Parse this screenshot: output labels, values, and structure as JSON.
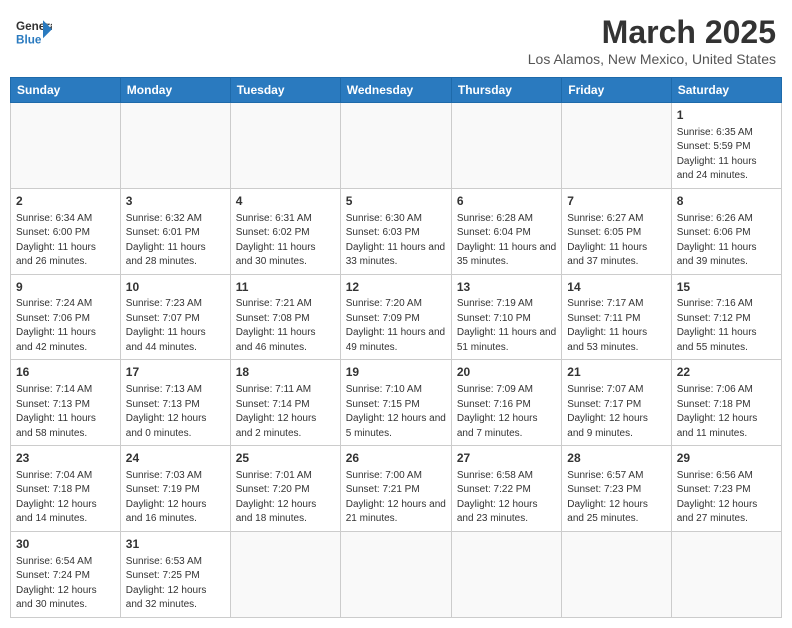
{
  "header": {
    "logo_general": "General",
    "logo_blue": "Blue",
    "month_title": "March 2025",
    "location": "Los Alamos, New Mexico, United States"
  },
  "days_of_week": [
    "Sunday",
    "Monday",
    "Tuesday",
    "Wednesday",
    "Thursday",
    "Friday",
    "Saturday"
  ],
  "weeks": [
    [
      {
        "day": "",
        "info": ""
      },
      {
        "day": "",
        "info": ""
      },
      {
        "day": "",
        "info": ""
      },
      {
        "day": "",
        "info": ""
      },
      {
        "day": "",
        "info": ""
      },
      {
        "day": "",
        "info": ""
      },
      {
        "day": "1",
        "info": "Sunrise: 6:35 AM\nSunset: 5:59 PM\nDaylight: 11 hours and 24 minutes."
      }
    ],
    [
      {
        "day": "2",
        "info": "Sunrise: 6:34 AM\nSunset: 6:00 PM\nDaylight: 11 hours and 26 minutes."
      },
      {
        "day": "3",
        "info": "Sunrise: 6:32 AM\nSunset: 6:01 PM\nDaylight: 11 hours and 28 minutes."
      },
      {
        "day": "4",
        "info": "Sunrise: 6:31 AM\nSunset: 6:02 PM\nDaylight: 11 hours and 30 minutes."
      },
      {
        "day": "5",
        "info": "Sunrise: 6:30 AM\nSunset: 6:03 PM\nDaylight: 11 hours and 33 minutes."
      },
      {
        "day": "6",
        "info": "Sunrise: 6:28 AM\nSunset: 6:04 PM\nDaylight: 11 hours and 35 minutes."
      },
      {
        "day": "7",
        "info": "Sunrise: 6:27 AM\nSunset: 6:05 PM\nDaylight: 11 hours and 37 minutes."
      },
      {
        "day": "8",
        "info": "Sunrise: 6:26 AM\nSunset: 6:06 PM\nDaylight: 11 hours and 39 minutes."
      }
    ],
    [
      {
        "day": "9",
        "info": "Sunrise: 7:24 AM\nSunset: 7:06 PM\nDaylight: 11 hours and 42 minutes."
      },
      {
        "day": "10",
        "info": "Sunrise: 7:23 AM\nSunset: 7:07 PM\nDaylight: 11 hours and 44 minutes."
      },
      {
        "day": "11",
        "info": "Sunrise: 7:21 AM\nSunset: 7:08 PM\nDaylight: 11 hours and 46 minutes."
      },
      {
        "day": "12",
        "info": "Sunrise: 7:20 AM\nSunset: 7:09 PM\nDaylight: 11 hours and 49 minutes."
      },
      {
        "day": "13",
        "info": "Sunrise: 7:19 AM\nSunset: 7:10 PM\nDaylight: 11 hours and 51 minutes."
      },
      {
        "day": "14",
        "info": "Sunrise: 7:17 AM\nSunset: 7:11 PM\nDaylight: 11 hours and 53 minutes."
      },
      {
        "day": "15",
        "info": "Sunrise: 7:16 AM\nSunset: 7:12 PM\nDaylight: 11 hours and 55 minutes."
      }
    ],
    [
      {
        "day": "16",
        "info": "Sunrise: 7:14 AM\nSunset: 7:13 PM\nDaylight: 11 hours and 58 minutes."
      },
      {
        "day": "17",
        "info": "Sunrise: 7:13 AM\nSunset: 7:13 PM\nDaylight: 12 hours and 0 minutes."
      },
      {
        "day": "18",
        "info": "Sunrise: 7:11 AM\nSunset: 7:14 PM\nDaylight: 12 hours and 2 minutes."
      },
      {
        "day": "19",
        "info": "Sunrise: 7:10 AM\nSunset: 7:15 PM\nDaylight: 12 hours and 5 minutes."
      },
      {
        "day": "20",
        "info": "Sunrise: 7:09 AM\nSunset: 7:16 PM\nDaylight: 12 hours and 7 minutes."
      },
      {
        "day": "21",
        "info": "Sunrise: 7:07 AM\nSunset: 7:17 PM\nDaylight: 12 hours and 9 minutes."
      },
      {
        "day": "22",
        "info": "Sunrise: 7:06 AM\nSunset: 7:18 PM\nDaylight: 12 hours and 11 minutes."
      }
    ],
    [
      {
        "day": "23",
        "info": "Sunrise: 7:04 AM\nSunset: 7:18 PM\nDaylight: 12 hours and 14 minutes."
      },
      {
        "day": "24",
        "info": "Sunrise: 7:03 AM\nSunset: 7:19 PM\nDaylight: 12 hours and 16 minutes."
      },
      {
        "day": "25",
        "info": "Sunrise: 7:01 AM\nSunset: 7:20 PM\nDaylight: 12 hours and 18 minutes."
      },
      {
        "day": "26",
        "info": "Sunrise: 7:00 AM\nSunset: 7:21 PM\nDaylight: 12 hours and 21 minutes."
      },
      {
        "day": "27",
        "info": "Sunrise: 6:58 AM\nSunset: 7:22 PM\nDaylight: 12 hours and 23 minutes."
      },
      {
        "day": "28",
        "info": "Sunrise: 6:57 AM\nSunset: 7:23 PM\nDaylight: 12 hours and 25 minutes."
      },
      {
        "day": "29",
        "info": "Sunrise: 6:56 AM\nSunset: 7:23 PM\nDaylight: 12 hours and 27 minutes."
      }
    ],
    [
      {
        "day": "30",
        "info": "Sunrise: 6:54 AM\nSunset: 7:24 PM\nDaylight: 12 hours and 30 minutes."
      },
      {
        "day": "31",
        "info": "Sunrise: 6:53 AM\nSunset: 7:25 PM\nDaylight: 12 hours and 32 minutes."
      },
      {
        "day": "",
        "info": ""
      },
      {
        "day": "",
        "info": ""
      },
      {
        "day": "",
        "info": ""
      },
      {
        "day": "",
        "info": ""
      },
      {
        "day": "",
        "info": ""
      }
    ]
  ]
}
